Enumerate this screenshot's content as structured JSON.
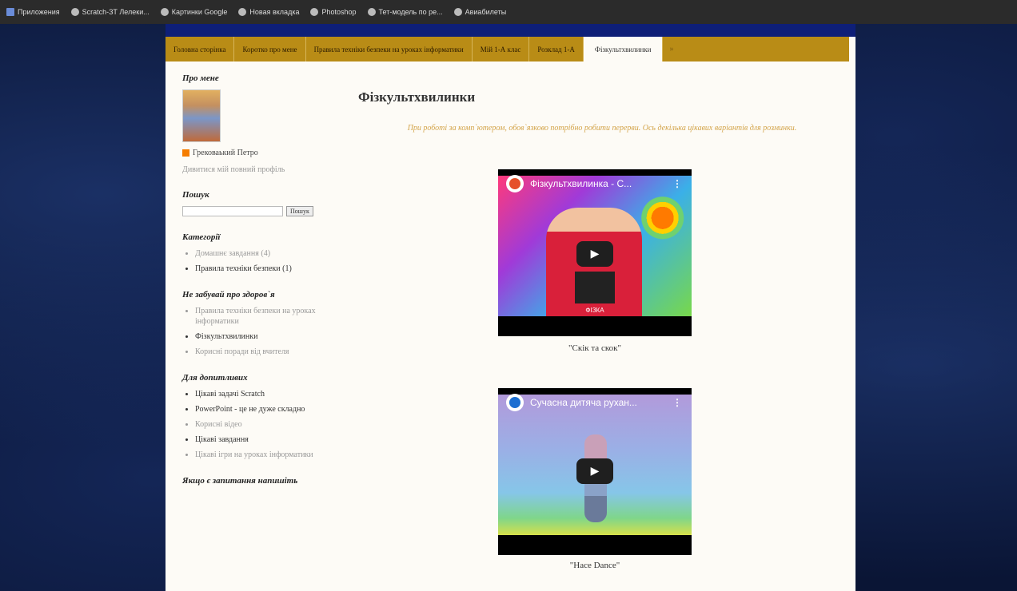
{
  "bookmarks": [
    {
      "label": "Приложения",
      "icon": "apps-grid-icon"
    },
    {
      "label": "Scratch-ЗТ Лелеки...",
      "icon": "globe-icon"
    },
    {
      "label": "Картинки Google",
      "icon": "globe-icon"
    },
    {
      "label": "Новая вкладка",
      "icon": "globe-icon"
    },
    {
      "label": "Photoshop",
      "icon": "globe-icon"
    },
    {
      "label": "Тет-модель по ре...",
      "icon": "globe-icon"
    },
    {
      "label": "Авиабилеты",
      "icon": "globe-icon"
    }
  ],
  "nav": {
    "tabs": [
      "Головна сторінка",
      "Коротко про мене",
      "Правила техніки безпеки на уроках інформатики",
      "Мій 1-А клас",
      "Розклад 1-А",
      "Фізкультхвилинки"
    ],
    "active_index": 5,
    "more_label": "»"
  },
  "sidebar": {
    "about": {
      "title": "Про мене",
      "name": "Грекова­ький Петро",
      "profile_link": "Дивитися мій повний профіль"
    },
    "search": {
      "title": "Пошук",
      "button": "Пошук"
    },
    "categories": {
      "title": "Категорії",
      "items": [
        {
          "label": "Домашнє завдання (4)",
          "muted": true
        },
        {
          "label": "Правила техніки безпеки (1)",
          "muted": false
        }
      ]
    },
    "health": {
      "title": "Не забувай про здоров`я",
      "items": [
        {
          "label": "Правила техніки безпеки на уроках інформатики",
          "muted": true
        },
        {
          "label": "Фізкультхвилинки",
          "muted": false
        },
        {
          "label": "Корисні поради від вчителя",
          "muted": true
        }
      ]
    },
    "curious": {
      "title": "Для допитливих",
      "items": [
        {
          "label": "Цікаві задачі Scratch",
          "muted": false
        },
        {
          "label": "PowerPoint - це не дуже складно",
          "muted": false
        },
        {
          "label": "Корисні відео",
          "muted": true
        },
        {
          "label": "Цікаві завдання",
          "muted": false
        },
        {
          "label": "Цікаві ігри на уроках інформатики",
          "muted": true
        }
      ]
    },
    "contact": {
      "title": "Якщо є запитання напишіть"
    }
  },
  "post": {
    "title": "Фізкультхвилинки",
    "intro": "При роботі за комп`ютером, обов`язково потрібно робити перерви. Ось декілька цікавих варіантів для розминки.",
    "videos": [
      {
        "title": "Фізкультхвилинка - С...",
        "caption": "\"Скік та скок\"",
        "channel_color": "#e5502a",
        "overlay_text": "ФІЗКА"
      },
      {
        "title": "Сучасна дитяча рухан...",
        "caption": "\"Hace Dance\"",
        "channel_color": "#1d6fd1",
        "overlay_text": ""
      }
    ]
  },
  "colors": {
    "nav_bg": "#b98c16",
    "intro_text": "#d3a44a",
    "page_bg": "#fdfbf6"
  }
}
